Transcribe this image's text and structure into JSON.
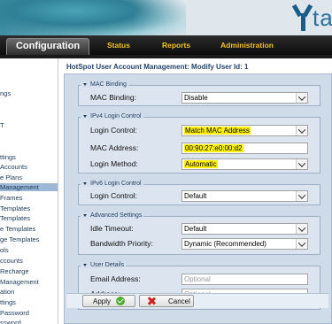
{
  "header": {
    "logo_text": "ta"
  },
  "nav": {
    "active": "Configuration",
    "items": [
      "Status",
      "Reports",
      "Administration"
    ]
  },
  "sidebar": {
    "items": [
      "ngs",
      "ttings",
      "Accounts",
      "e Plans",
      "Management",
      "Frames",
      "Templates",
      "Templates",
      "e Templates",
      "ge Templates",
      "ols",
      "ccounts",
      "Recharge",
      "Management",
      "ation",
      "ttings",
      "Password",
      "ssword"
    ],
    "extra": [
      "T"
    ]
  },
  "main": {
    "title": "HotSpot User Account Management: Modify User Id: 1",
    "sections": {
      "mac": {
        "legend": "MAC Binding",
        "binding_label": "MAC Binding:",
        "binding_value": "Disable"
      },
      "ipv4": {
        "legend": "IPv4 Login Control",
        "login_control_label": "Login Control:",
        "login_control_value": "Match MAC Address",
        "mac_address_label": "MAC Address:",
        "mac_address_value": "00:90:27:e0:00:d2",
        "login_method_label": "Login Method:",
        "login_method_value": "Automatic"
      },
      "ipv6": {
        "legend": "IPv6 Login Control",
        "login_control_label": "Login Control:",
        "login_control_value": "Default"
      },
      "advanced": {
        "legend": "Advanced Settings",
        "idle_label": "Idle Timeout:",
        "idle_value": "Default",
        "bw_label": "Bandwidth Priority:",
        "bw_value": "Dynamic (Recommended)"
      },
      "user": {
        "legend": "User Details",
        "email_label": "Email Address:",
        "email_placeholder": "Optional",
        "address_label": "Address:",
        "address_placeholder": "Optional"
      }
    },
    "buttons": {
      "apply": "Apply",
      "cancel": "Cancel"
    }
  },
  "colors": {
    "highlight": "#fff200",
    "nav_text": "#f2c11c",
    "panel_bg": "#cfdbe8"
  }
}
